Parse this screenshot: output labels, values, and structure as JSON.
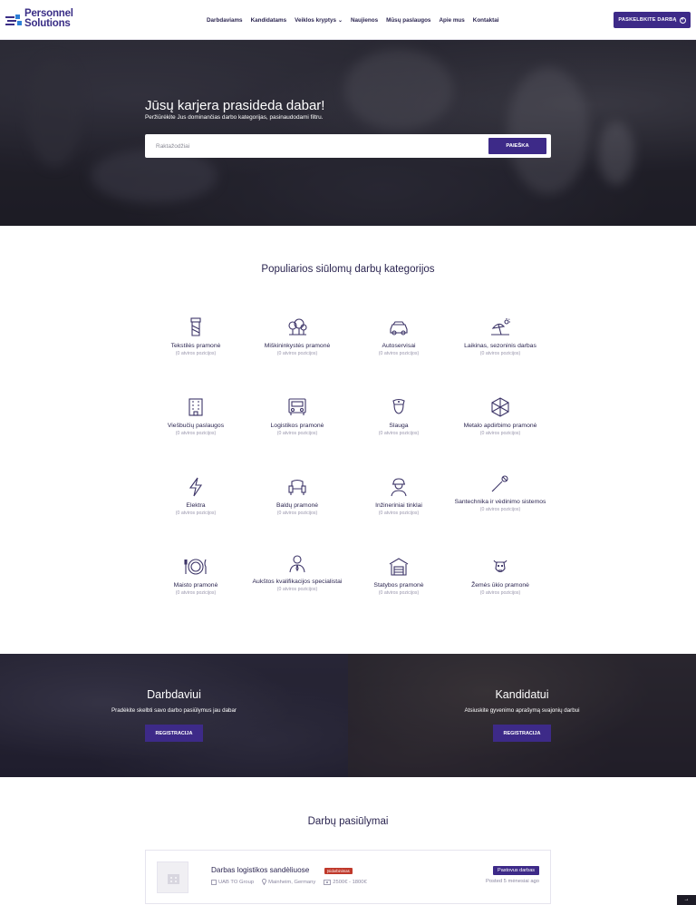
{
  "header": {
    "logo_line1": "Personnel",
    "logo_line2": "Solutions",
    "nav": [
      "Darbdaviams",
      "Kandidatams",
      "Veiklos kryptys",
      "Naujienos",
      "Mūsų paslaugos",
      "Apie mus",
      "Kontaktai"
    ],
    "post_button": "PASKELBKITE DARBĄ"
  },
  "hero": {
    "title": "Jūsų karjera prasideda dabar!",
    "subtitle": "Peržiūrėkite Jus dominančias darbo kategorijas, pasinaudodami filtru.",
    "search_placeholder": "Raktažodžiai",
    "search_button": "PAIEŠKA"
  },
  "categories_title": "Populiarios siūlomų darbų kategorijos",
  "categories": [
    {
      "name": "Tekstilės pramonė",
      "count": "(0 atviros pozicijos)",
      "icon": "textile-icon"
    },
    {
      "name": "Miškininkystės pramonė",
      "count": "(0 atviros pozicijos)",
      "icon": "forestry-icon"
    },
    {
      "name": "Autoservisai",
      "count": "(0 atviros pozicijos)",
      "icon": "car-icon"
    },
    {
      "name": "Laikinas, sezoninis darbas",
      "count": "(0 atviros pozicijos)",
      "icon": "beach-icon"
    },
    {
      "name": "Viešbučių paslaugos",
      "count": "(0 atviros pozicijos)",
      "icon": "hotel-icon"
    },
    {
      "name": "Logistikos pramonė",
      "count": "(0 atviros pozicijos)",
      "icon": "truck-icon"
    },
    {
      "name": "Slauga",
      "count": "(0 atviros pozicijos)",
      "icon": "nurse-icon"
    },
    {
      "name": "Metalo apdirbimo pramonė",
      "count": "(0 atviros pozicijos)",
      "icon": "metal-icon"
    },
    {
      "name": "Elektra",
      "count": "(0 atviros pozicijos)",
      "icon": "lightning-icon"
    },
    {
      "name": "Baldų pramonė",
      "count": "(0 atviros pozicijos)",
      "icon": "armchair-icon"
    },
    {
      "name": "Inžineriniai tinklai",
      "count": "(0 atviros pozicijos)",
      "icon": "engineer-icon"
    },
    {
      "name": "Santechnika ir vėdinimo sistemos",
      "count": "(0 atviros pozicijos)",
      "icon": "tools-icon"
    },
    {
      "name": "Maisto pramonė",
      "count": "(0 atviros pozicijos)",
      "icon": "plate-icon"
    },
    {
      "name": "Aukštos kvalifikacijos specialistai",
      "count": "(0 atviros pozicijos)",
      "icon": "specialist-icon"
    },
    {
      "name": "Statybos pramonė",
      "count": "(0 atviros pozicijos)",
      "icon": "garage-icon"
    },
    {
      "name": "Žemės ūkio pramonė",
      "count": "(0 atviros pozicijos)",
      "icon": "cow-icon"
    }
  ],
  "employer": {
    "title": "Darbdaviui",
    "text": "Pradėkite skelbti savo darbo pasiūlymus jau dabar",
    "button": "REGISTRACIJA"
  },
  "candidate": {
    "title": "Kandidatui",
    "text": "Atsiuskite gyvenimo aprašymą svajonių darbui",
    "button": "REGISTRACIJA"
  },
  "jobs_title": "Darbų pasiūlymai",
  "job": {
    "title": "Darbas logistikos sandėliuose",
    "tag": "Įsidarbinimas",
    "company": "UAB TO Group",
    "location": "Mainheim, Germany",
    "salary": "2500€ - 1800€",
    "type": "Pastovus darbas",
    "posted": "Posted 5 mėnesiai ago"
  },
  "colors": {
    "primary": "#3d2a88",
    "text": "#2b2550",
    "muted": "#9a97ad",
    "badge_red": "#c0392b"
  }
}
